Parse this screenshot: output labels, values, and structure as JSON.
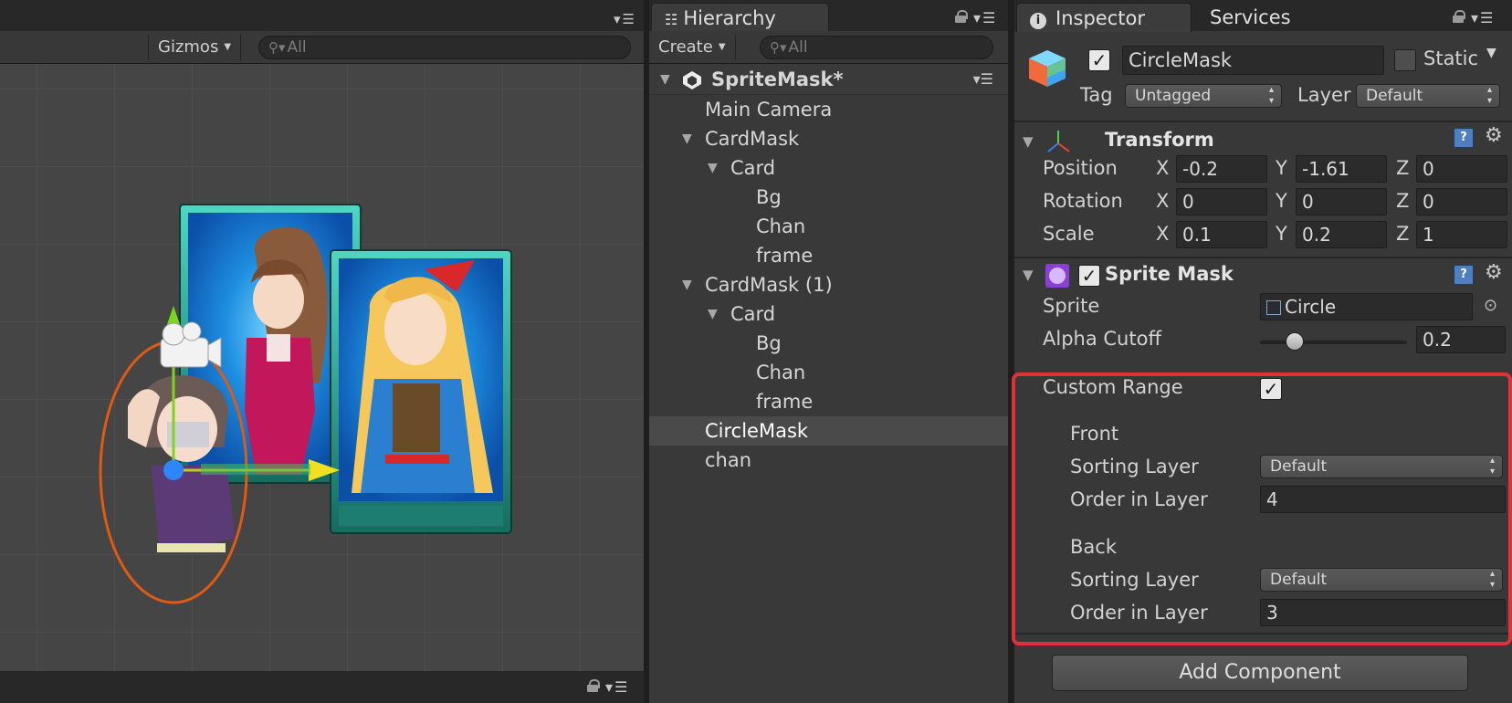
{
  "scene": {
    "toolbar": {
      "gizmos_label": "Gizmos",
      "search_placeholder": "All"
    }
  },
  "hierarchy": {
    "tab_label": "Hierarchy",
    "create_label": "Create",
    "search_placeholder": "All",
    "scene_name": "SpriteMask*",
    "items": [
      {
        "label": "Main Camera"
      },
      {
        "label": "CardMask"
      },
      {
        "label": "Card"
      },
      {
        "label": "Bg"
      },
      {
        "label": "Chan"
      },
      {
        "label": "frame"
      },
      {
        "label": "CardMask (1)"
      },
      {
        "label": "Card"
      },
      {
        "label": "Bg"
      },
      {
        "label": "Chan"
      },
      {
        "label": "frame"
      },
      {
        "label": "CircleMask"
      },
      {
        "label": "chan"
      }
    ]
  },
  "inspector": {
    "tabs": [
      {
        "label": "Inspector"
      },
      {
        "label": "Services"
      }
    ],
    "object": {
      "name": "CircleMask",
      "static_label": "Static",
      "tag_label": "Tag",
      "tag_value": "Untagged",
      "layer_label": "Layer",
      "layer_value": "Default"
    },
    "transform": {
      "title": "Transform",
      "position": {
        "label": "Position",
        "x": "-0.2",
        "y": "-1.61",
        "z": "0"
      },
      "rotation": {
        "label": "Rotation",
        "x": "0",
        "y": "0",
        "z": "0"
      },
      "scale": {
        "label": "Scale",
        "x": "0.1",
        "y": "0.2",
        "z": "1"
      },
      "axis_x": "X",
      "axis_y": "Y",
      "axis_z": "Z"
    },
    "sprite_mask": {
      "title": "Sprite Mask",
      "sprite_label": "Sprite",
      "sprite_value": "Circle",
      "alpha_cutoff_label": "Alpha Cutoff",
      "alpha_cutoff_value": "0.2",
      "alpha_cutoff_fraction": 0.2,
      "custom_range_label": "Custom Range",
      "front_label": "Front",
      "front_sorting_layer_label": "Sorting Layer",
      "front_sorting_layer_value": "Default",
      "front_order_label": "Order in Layer",
      "front_order_value": "4",
      "back_label": "Back",
      "back_sorting_layer_label": "Sorting Layer",
      "back_sorting_layer_value": "Default",
      "back_order_label": "Order in Layer",
      "back_order_value": "3"
    },
    "add_component_label": "Add Component"
  },
  "colors": {
    "highlight": "#e0303a",
    "mask_outline": "#e05a14",
    "card_frame": "#2fa89a",
    "card_bg": "#2a8fd8"
  },
  "icons": {
    "search": "magnifier-icon",
    "lock": "lock-icon",
    "menu": "panel-menu-icon",
    "help": "help-icon",
    "gear": "gear-icon",
    "camera": "camera-gizmo-icon"
  }
}
